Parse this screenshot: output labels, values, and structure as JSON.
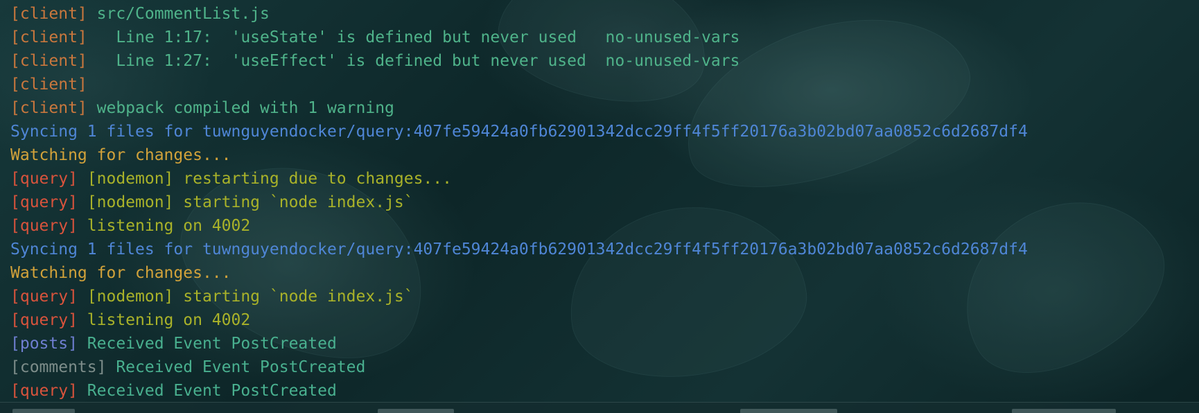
{
  "log": [
    {
      "tag": "[client]",
      "tag_color": "client",
      "text": " src/CommentList.js",
      "text_color": "green"
    },
    {
      "tag": "[client]",
      "tag_color": "client",
      "text": "   Line 1:17:  'useState' is defined but never used   no-unused-vars",
      "text_color": "green"
    },
    {
      "tag": "[client]",
      "tag_color": "client",
      "text": "   Line 1:27:  'useEffect' is defined but never used  no-unused-vars",
      "text_color": "green"
    },
    {
      "tag": "[client]",
      "tag_color": "client",
      "text": "",
      "text_color": "green"
    },
    {
      "tag": "[client]",
      "tag_color": "client",
      "text": " webpack compiled with 1 warning",
      "text_color": "green"
    },
    {
      "tag": "",
      "tag_color": "blue",
      "text": "Syncing 1 files for tuwnguyendocker/query:407fe59424a0fb62901342dcc29ff4f5ff20176a3b02bd07aa0852c6d2687df4",
      "text_color": "blue"
    },
    {
      "tag": "",
      "tag_color": "yellow",
      "text": "Watching for changes...",
      "text_color": "yellow"
    },
    {
      "tag": "[query]",
      "tag_color": "query",
      "text": " [nodemon] restarting due to changes...",
      "text_color": "olive"
    },
    {
      "tag": "[query]",
      "tag_color": "query",
      "text": " [nodemon] starting `node index.js`",
      "text_color": "olive"
    },
    {
      "tag": "[query]",
      "tag_color": "query",
      "text": " listening on 4002",
      "text_color": "olive"
    },
    {
      "tag": "",
      "tag_color": "blue",
      "text": "Syncing 1 files for tuwnguyendocker/query:407fe59424a0fb62901342dcc29ff4f5ff20176a3b02bd07aa0852c6d2687df4",
      "text_color": "blue"
    },
    {
      "tag": "",
      "tag_color": "yellow",
      "text": "Watching for changes...",
      "text_color": "yellow"
    },
    {
      "tag": "[query]",
      "tag_color": "query",
      "text": " [nodemon] starting `node index.js`",
      "text_color": "olive"
    },
    {
      "tag": "[query]",
      "tag_color": "query",
      "text": " listening on 4002",
      "text_color": "olive"
    },
    {
      "tag": "[posts]",
      "tag_color": "posts",
      "text": " Received Event PostCreated",
      "text_color": "teal"
    },
    {
      "tag": "[comments]",
      "tag_color": "comments",
      "text": " Received Event PostCreated",
      "text_color": "teal"
    },
    {
      "tag": "[query]",
      "tag_color": "query",
      "text": " Received Event PostCreated",
      "text_color": "teal"
    }
  ],
  "colors": {
    "client": "#c9773d",
    "query": "#d9533c",
    "posts": "#6f7fd1",
    "comments": "#7d8d8a",
    "green": "#4fb38a",
    "teal": "#49b08f",
    "olive": "#a9b229",
    "blue": "#4f86d6",
    "yellow": "#d2a23a"
  }
}
